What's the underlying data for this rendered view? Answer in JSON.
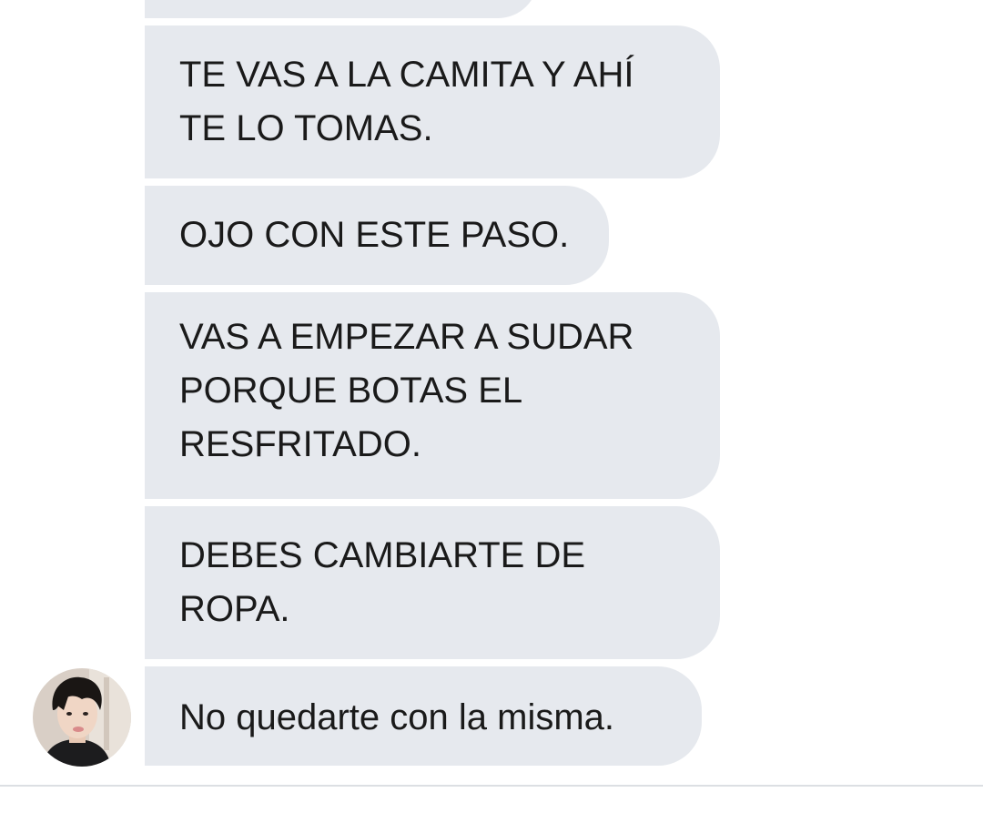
{
  "conversation": {
    "messages": [
      {
        "text": ""
      },
      {
        "text": "TE VAS A LA CAMITA Y AHÍ\nTE LO TOMAS."
      },
      {
        "text": "OJO CON ESTE PASO."
      },
      {
        "text": "VAS A EMPEZAR A SUDAR\nPORQUE BOTAS EL\nRESFRITADO."
      },
      {
        "text": "DEBES CAMBIARTE DE\nROPA."
      },
      {
        "text": "No quedarte con la misma."
      }
    ]
  },
  "sender": {
    "avatar_icon": "user-avatar-photo"
  },
  "colors": {
    "bubble_background": "#e6e9ee",
    "text": "#1a1a1a",
    "background": "#ffffff"
  }
}
